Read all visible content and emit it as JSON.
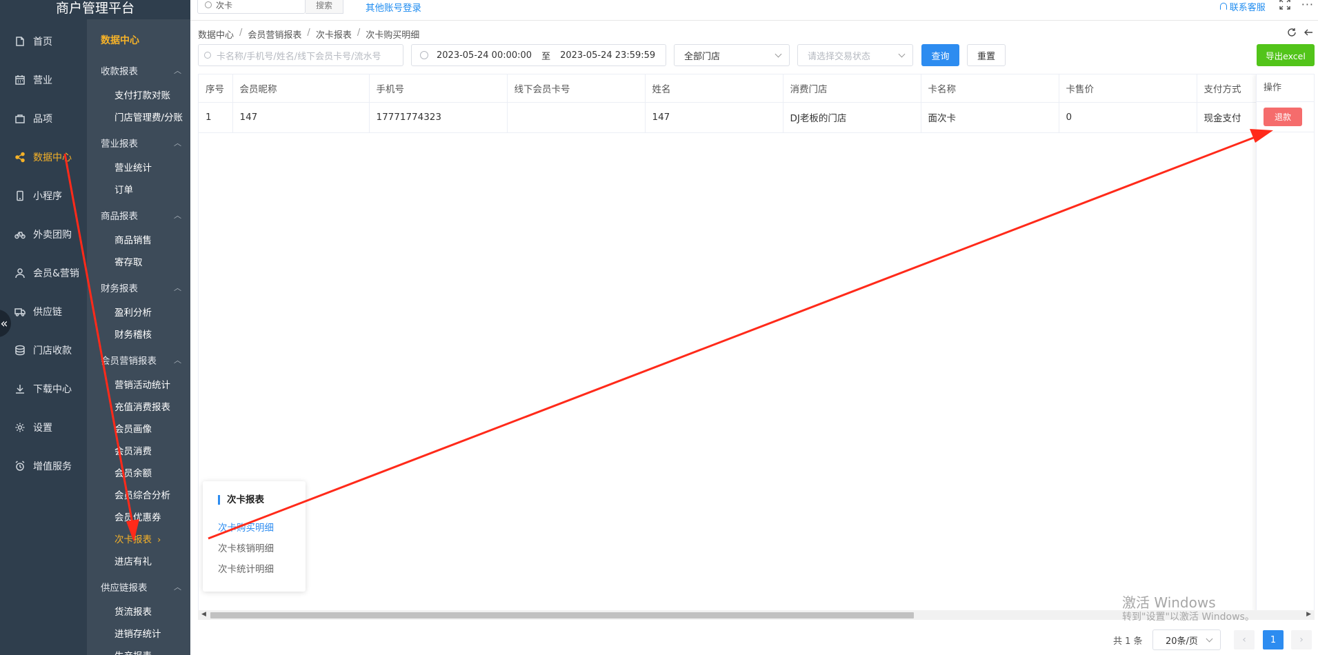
{
  "app": {
    "title": "商户管理平台"
  },
  "topbar": {
    "search_value": "次卡",
    "search_button": "搜索",
    "other_login": "其他账号登录",
    "service": "联系客服",
    "more": "···"
  },
  "nav": {
    "items": [
      {
        "label": "首页",
        "icon": "home-icon"
      },
      {
        "label": "营业",
        "icon": "calendar-icon"
      },
      {
        "label": "品项",
        "icon": "bag-icon"
      },
      {
        "label": "数据中心",
        "icon": "share-icon",
        "active": true
      },
      {
        "label": "小程序",
        "icon": "phone-icon"
      },
      {
        "label": "外卖团购",
        "icon": "bike-icon"
      },
      {
        "label": "会员&营销",
        "icon": "user-icon"
      },
      {
        "label": "供应链",
        "icon": "truck-icon"
      },
      {
        "label": "门店收款",
        "icon": "coins-icon"
      },
      {
        "label": "下载中心",
        "icon": "download-icon"
      },
      {
        "label": "设置",
        "icon": "gear-icon"
      },
      {
        "label": "增值服务",
        "icon": "alarm-icon"
      }
    ],
    "collapse": "«"
  },
  "subnav": {
    "title": "数据中心",
    "groups": [
      {
        "label": "收款报表",
        "links": [
          "支付打款对账",
          "门店管理费/分账"
        ]
      },
      {
        "label": "营业报表",
        "links": [
          "营业统计",
          "订单"
        ]
      },
      {
        "label": "商品报表",
        "links": [
          "商品销售",
          "寄存取"
        ]
      },
      {
        "label": "财务报表",
        "links": [
          "盈利分析",
          "财务稽核"
        ]
      },
      {
        "label": "会员营销报表",
        "links": [
          "营销活动统计",
          "充值消费报表",
          "会员画像",
          "会员消费",
          "会员余额",
          "会员综合分析",
          "会员优惠券",
          "次卡报表",
          "进店有礼"
        ]
      },
      {
        "label": "供应链报表",
        "links": [
          "货流报表",
          "进销存统计",
          "生产报表"
        ]
      }
    ],
    "active_link": "次卡报表"
  },
  "breadcrumb": [
    "数据中心",
    "会员营销报表",
    "次卡报表",
    "次卡购买明细"
  ],
  "filters": {
    "keyword_placeholder": "卡名称/手机号/姓名/线下会员卡号/流水号",
    "date_start": "2023-05-24 00:00:00",
    "date_to": "至",
    "date_end": "2023-05-24 23:59:59",
    "store": "全部门店",
    "status_placeholder": "请选择交易状态",
    "query": "查询",
    "reset": "重置",
    "export": "导出excel"
  },
  "table": {
    "columns": [
      "序号",
      "会员昵称",
      "手机号",
      "线下会员卡号",
      "姓名",
      "消费门店",
      "卡名称",
      "卡售价",
      "支付方式"
    ],
    "op_header": "操作",
    "rows": [
      {
        "cells": [
          "1",
          "147",
          "17771774323",
          "",
          "147",
          "DJ老板的门店",
          "面次卡",
          "0",
          "现金支付"
        ],
        "action": "退款"
      }
    ]
  },
  "pagination": {
    "total": "共 1 条",
    "page_size": "20条/页",
    "current": "1",
    "prev": "‹",
    "next": "›"
  },
  "popup": {
    "title": "次卡报表",
    "links": [
      "次卡购买明细",
      "次卡核销明细",
      "次卡统计明细"
    ],
    "active": "次卡购买明细"
  },
  "watermark": {
    "line1": "激活 Windows",
    "line2": "转到\"设置\"以激活 Windows。"
  },
  "colors": {
    "nav_bg": "#2f3e4d",
    "subnav_bg": "#3d4b59",
    "active": "#f6b228",
    "primary": "#2d8cf0",
    "success": "#52c41a",
    "danger": "#f56c6c",
    "annotation_arrow": "#ff2a1a"
  }
}
